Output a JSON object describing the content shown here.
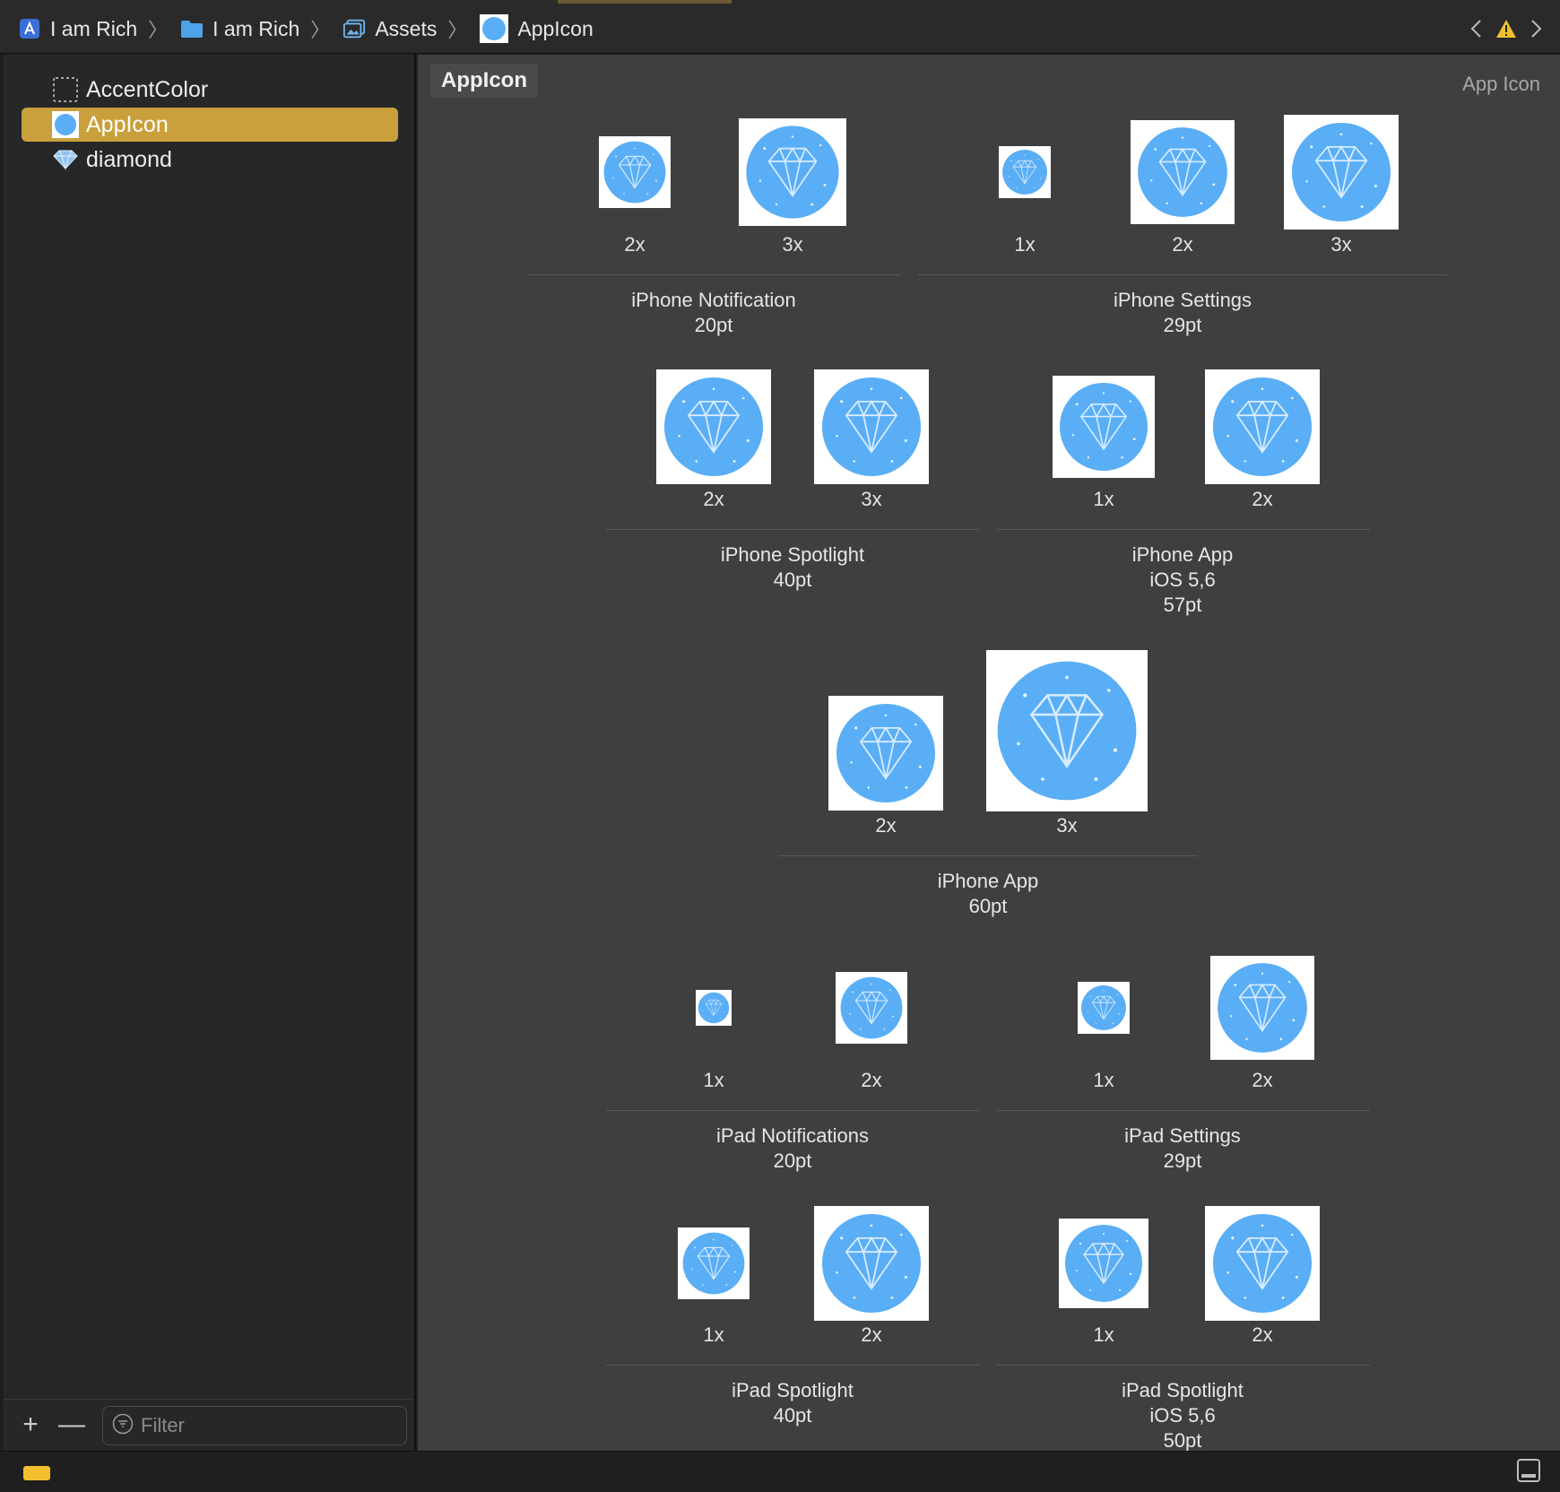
{
  "breadcrumbs": [
    {
      "label": "I am Rich",
      "icon": "xcode-project-icon"
    },
    {
      "label": "I am Rich",
      "icon": "folder-icon"
    },
    {
      "label": "Assets",
      "icon": "asset-catalog-icon"
    },
    {
      "label": "AppIcon",
      "icon": "app-icon-thumbnail"
    }
  ],
  "nav": {
    "back": "‹",
    "forward": "›",
    "warning_icon": "warning-icon"
  },
  "sidebar": {
    "items": [
      {
        "label": "AccentColor",
        "icon": "color-set-icon"
      },
      {
        "label": "AppIcon",
        "icon": "app-icon-thumbnail"
      },
      {
        "label": "diamond",
        "icon": "diamond-icon"
      }
    ],
    "selected": "AppIcon",
    "add": "+",
    "remove": "—",
    "filter_placeholder": "Filter"
  },
  "main": {
    "title": "AppIcon",
    "set_type": "App Icon",
    "groups": [
      {
        "label": [
          "iPhone Notification",
          "20pt"
        ],
        "slots": [
          "2x",
          "3x"
        ]
      },
      {
        "label": [
          "iPhone Settings",
          "29pt"
        ],
        "slots": [
          "1x",
          "2x",
          "3x"
        ]
      },
      {
        "label": [
          "iPhone Spotlight",
          "40pt"
        ],
        "slots": [
          "2x",
          "3x"
        ]
      },
      {
        "label": [
          "iPhone App",
          "iOS 5,6",
          "57pt"
        ],
        "slots": [
          "1x",
          "2x"
        ]
      },
      {
        "label": [
          "iPhone App",
          "60pt"
        ],
        "slots": [
          "2x",
          "3x"
        ]
      },
      {
        "label": [
          "iPad Notifications",
          "20pt"
        ],
        "slots": [
          "1x",
          "2x"
        ]
      },
      {
        "label": [
          "iPad Settings",
          "29pt"
        ],
        "slots": [
          "1x",
          "2x"
        ]
      },
      {
        "label": [
          "iPad Spotlight",
          "40pt"
        ],
        "slots": [
          "1x",
          "2x"
        ]
      },
      {
        "label": [
          "iPad Spotlight",
          "iOS 5,6",
          "50pt"
        ],
        "slots": [
          "1x",
          "2x"
        ]
      }
    ]
  },
  "colors": {
    "selection": "#c9a03c",
    "icon_blue": "#5aaef5",
    "warning": "#f2c02e"
  }
}
